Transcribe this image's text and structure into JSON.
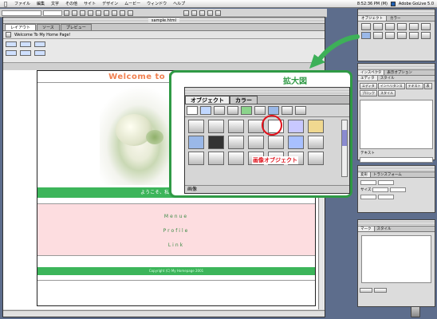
{
  "menubar": {
    "items": [
      "ファイル",
      "編集",
      "文字",
      "その他",
      "サイト",
      "デザイン",
      "ムービー",
      "ウィンドウ",
      "ヘルプ"
    ],
    "clock": "8:52:36 PM (M)",
    "app": "Adobe GoLive 5.0"
  },
  "doc": {
    "title": "sample.html",
    "tabs": [
      "レイアウト",
      "ソース",
      "プレビュー"
    ],
    "page_title": "Welcome To My Home Page!"
  },
  "page": {
    "heading": "Welcome to My Home Page!",
    "banner": "ようこそ、私のホームページへ！",
    "links": [
      "Menue",
      "Profile",
      "Link"
    ],
    "footer": "Copyright (C) My Homepage 2001"
  },
  "callout": {
    "label": "拡大図",
    "panel_tabs": [
      "オブジェクト",
      "カラー"
    ],
    "status": "画像",
    "annotation": "画像オブジェクト"
  },
  "palette": {
    "title": "オブジェクト",
    "tab2": "カラー"
  },
  "inspector": {
    "tabs": [
      "インスペクタ",
      "表示オプション"
    ],
    "subtabs": [
      "エディタ",
      "スタイル"
    ],
    "button_labels": [
      "エディタ",
      "インヘリタンス",
      "テキスト",
      "表",
      "ブロック",
      "スタイル"
    ],
    "label_text": "テキスト"
  },
  "trans": {
    "tabs": [
      "変形",
      "トランスフォーム",
      "サイズ"
    ]
  },
  "css": {
    "tabs": [
      "マーク",
      "スタイル"
    ]
  },
  "colors": {
    "green": "#3cb55a",
    "pink": "#fddde0",
    "heading": "#f08050",
    "callout_border": "#2f9a45",
    "annotation": "#e0101a"
  },
  "icons": {
    "callout_arrow": "green-arrow-icon",
    "highlight": "red-circle-highlight",
    "trash": "trash-icon"
  }
}
